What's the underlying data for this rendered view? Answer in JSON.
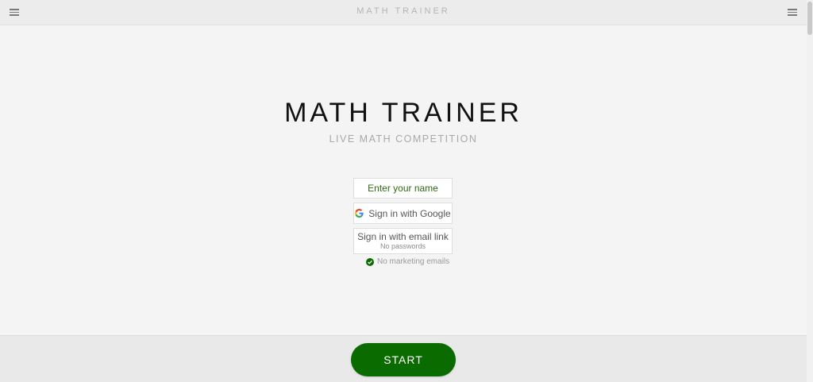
{
  "header": {
    "title": "MATH TRAINER",
    "left_menu_icon": "hamburger-menu-icon",
    "right_menu_icon": "hamburger-menu-icon"
  },
  "hero": {
    "title": "MATH TRAINER",
    "subtitle": "LIVE MATH COMPETITION"
  },
  "form": {
    "name_placeholder": "Enter your name",
    "google_label": "Sign in with Google",
    "google_icon": "google-logo-icon",
    "email_label": "Sign in with email link",
    "email_sublabel": "No passwords",
    "no_marketing_label": "No marketing emails",
    "no_marketing_icon": "check-circle-icon"
  },
  "footer": {
    "start_label": "START"
  },
  "colors": {
    "accent": "#0a6b00",
    "background": "#f4f4f4",
    "title_text": "#111111",
    "subtitle_text": "#a9a9a9"
  }
}
